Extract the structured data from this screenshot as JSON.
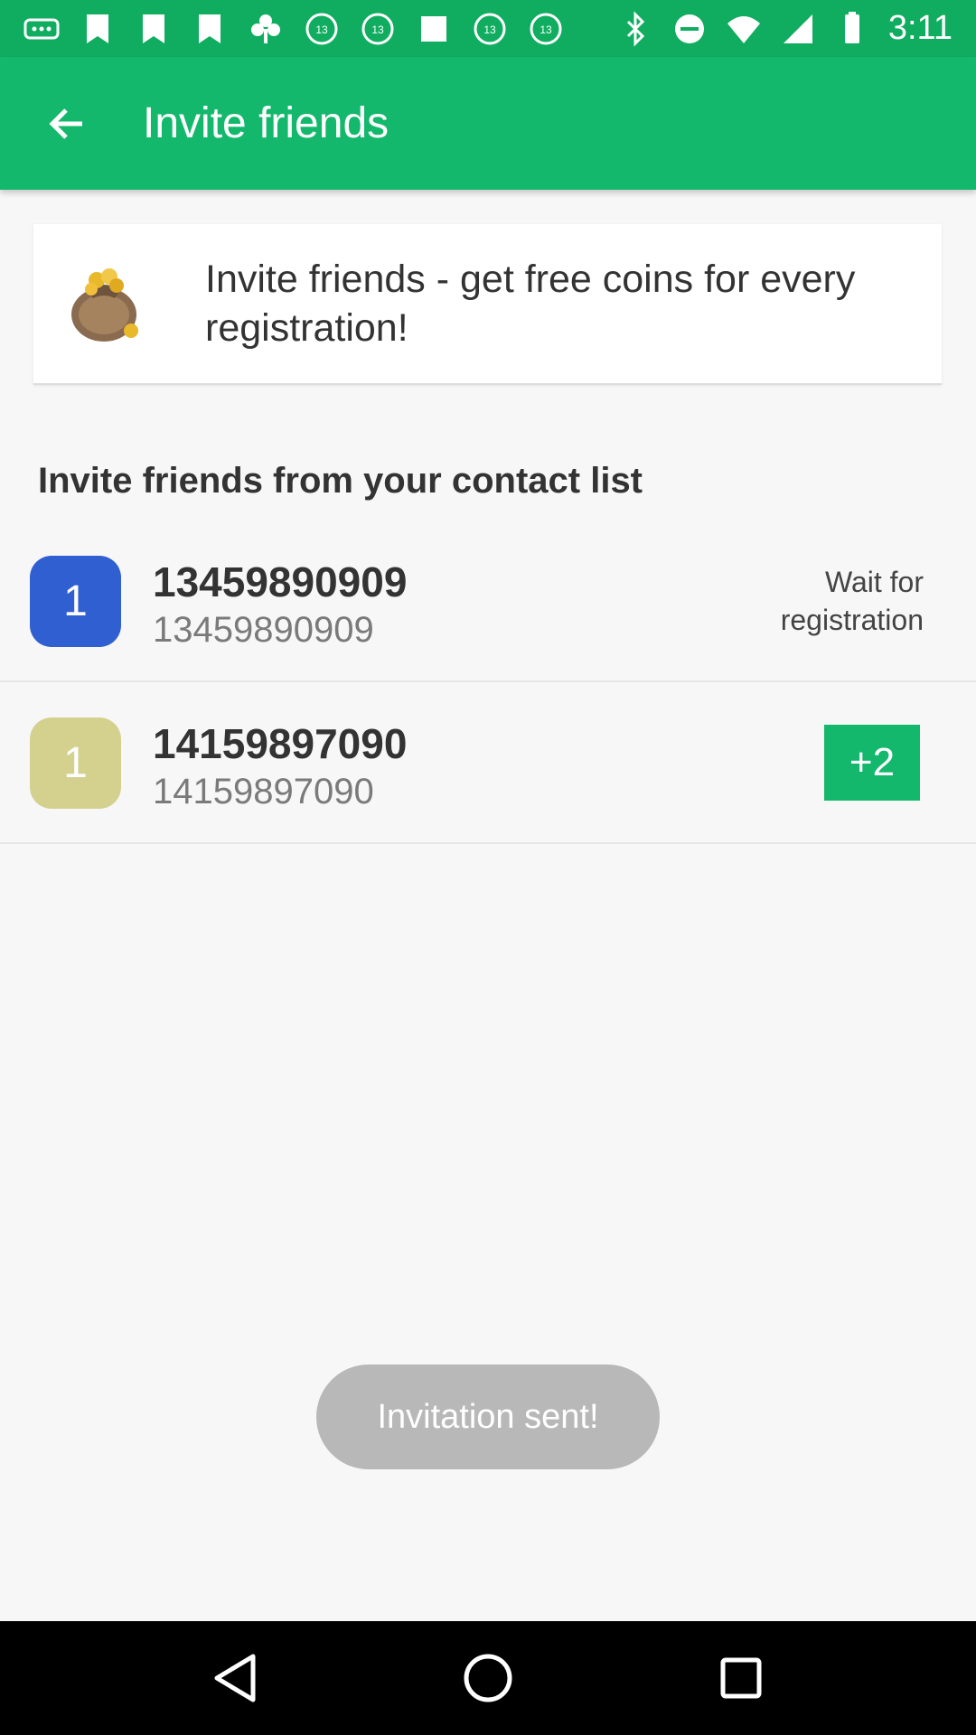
{
  "status_bar": {
    "time": "3:11",
    "icons": [
      "more-icon",
      "bookmark-icon",
      "bookmark-icon",
      "bookmark-icon",
      "club-icon",
      "abc13-icon",
      "abc13-icon",
      "square-icon",
      "abc13-icon",
      "abc13-icon",
      "bluetooth-icon",
      "do-not-disturb-icon",
      "wifi-icon",
      "signal-icon",
      "battery-icon"
    ]
  },
  "app_bar": {
    "title": "Invite friends",
    "back_icon": "arrow-back-icon"
  },
  "promo": {
    "icon": "coin-bag-icon",
    "text": "Invite friends - get free coins for every registration!"
  },
  "section": {
    "title": "Invite friends from your contact list"
  },
  "contacts": [
    {
      "badge": "1",
      "badge_color": "#2f5fd0",
      "name": "13459890909",
      "number": "13459890909",
      "status": "Wait for registration"
    },
    {
      "badge": "1",
      "badge_color": "#d4d18e",
      "name": "14159897090",
      "number": "14159897090",
      "action": "+2"
    }
  ],
  "toast": {
    "text": "Invitation sent!"
  },
  "colors": {
    "accent": "#14b86c",
    "status_bar": "#10ad60"
  }
}
